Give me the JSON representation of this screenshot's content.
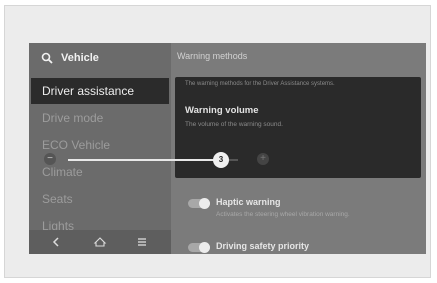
{
  "sidebar": {
    "title": "Vehicle",
    "items": [
      {
        "label": "Driver assistance",
        "active": true
      },
      {
        "label": "Drive mode",
        "active": false
      },
      {
        "label": "ECO Vehicle",
        "active": false
      },
      {
        "label": "Climate",
        "active": false
      },
      {
        "label": "Seats",
        "active": false
      },
      {
        "label": "Lights",
        "active": false
      }
    ],
    "nav_icons": [
      "back-icon",
      "home-icon",
      "menu-icon"
    ]
  },
  "main": {
    "header": "Warning methods",
    "popup": {
      "description": "The warning methods for the Driver Assistance systems.",
      "title": "Warning volume",
      "subtitle": "The volume of the warning sound.",
      "slider": {
        "value": "3",
        "fraction": 0.9
      },
      "minus_symbol": "−",
      "plus_symbol": "+"
    },
    "options": [
      {
        "label": "Haptic warning",
        "description": "Activates the steering wheel vibration warning.",
        "on": true
      },
      {
        "label": "Driving safety priority",
        "on": true
      }
    ]
  },
  "colors": {
    "screen_bg": "#7b7b7b",
    "sidebar_bg": "#6b6b6b",
    "active_item_bg": "#2b2b2b",
    "popup_bg": "#2a2a2a"
  }
}
